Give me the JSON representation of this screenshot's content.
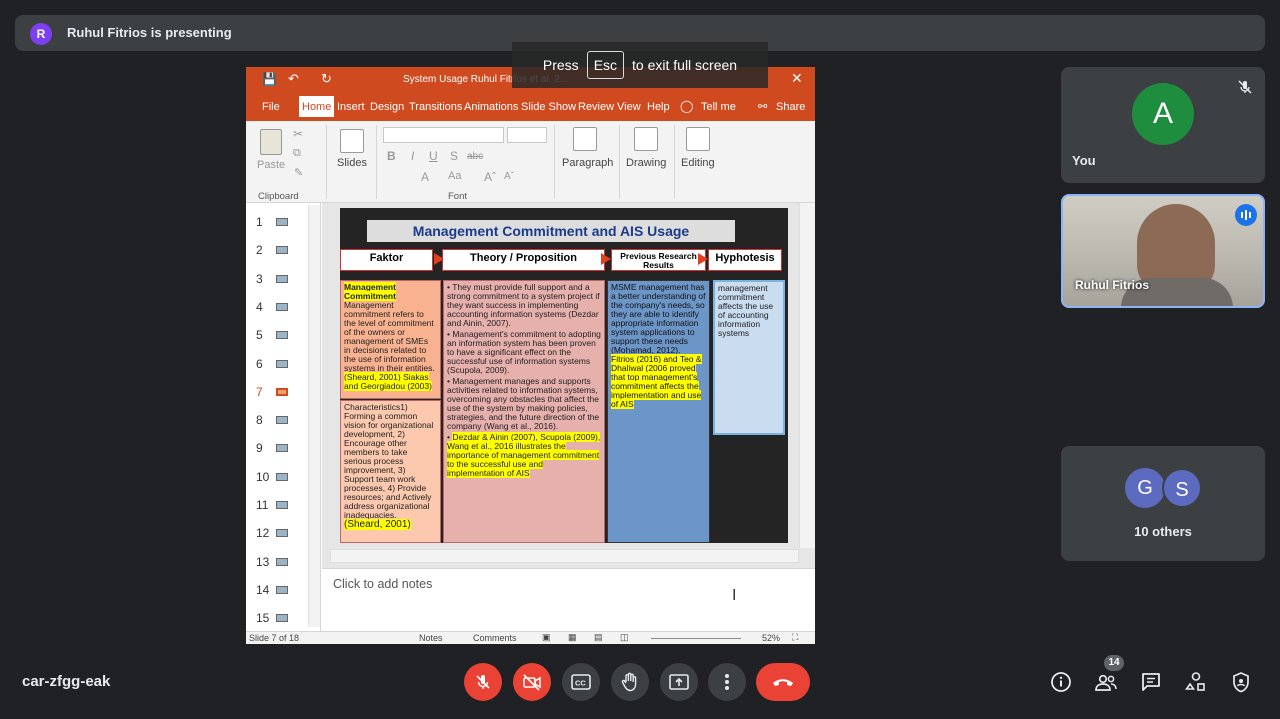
{
  "presenting_bar": {
    "avatar_letter": "R",
    "text": "Ruhul Fitrios is presenting"
  },
  "fullscreen_toast": {
    "before": "Press",
    "key": "Esc",
    "after": "to exit full screen"
  },
  "ppt": {
    "doc_title": "System Usage Ruhul Fitrios et al. 2...",
    "tabs": [
      "File",
      "Home",
      "Insert",
      "Design",
      "Transitions",
      "Animations",
      "Slide Show",
      "Review",
      "View",
      "Help",
      "Tell me",
      "Share"
    ],
    "active_tab": "Home",
    "ribbon": {
      "paste": "Paste",
      "clipboard": "Clipboard",
      "slides": "Slides",
      "font": "Font",
      "paragraph": "Paragraph",
      "drawing": "Drawing",
      "editing": "Editing"
    },
    "thumbnails": [
      "1",
      "2",
      "3",
      "4",
      "5",
      "6",
      "7",
      "8",
      "9",
      "10",
      "11",
      "12",
      "13",
      "14",
      "15"
    ],
    "active_thumbnail": "7",
    "slide": {
      "title": "Management Commitment and AIS Usage",
      "headers": [
        "Faktor",
        "Theory / Proposition",
        "Previous Research Results",
        "Hyphotesis"
      ],
      "col1_title": "Management Commitment",
      "col1_body": "Management commitment refers to the level of commitment of the owners or management of SMEs in decisions related to the use of information systems in their entities.",
      "col1_cite": "(Sheard, 2001) Siakas and Georgiadou (2003)",
      "col1b_body": "Characteristics1) Forming a common vision for organizational development, 2) Encourage other members to take serious process improvement, 3) Support team work processes, 4) Provide resources; and Actively address organizational inadequacies.",
      "col1b_cite": "(Sheard, 2001)",
      "col2_items": [
        "They must provide full support and a strong commitment to a system project if they want success in implementing accounting information systems (Dezdar and Ainin, 2007).",
        "Management's commitment to adopting an information system has been proven to have a significant effect on the successful use of information systems (Scupola, 2009).",
        "Management manages and supports activities related to information systems, overcoming any obstacles that affect the use of the system by making policies, strategies, and the future direction of the company (Wang et al., 2016)."
      ],
      "col2_hl": "Dezdar & Ainin (2007), Scupola (2009), Wang et al., 2016 illustrates the importance of management commitment to the successful use and implementation of AIS",
      "col3_body": "MSME management has a better understanding of the company's needs, so they are able to identify appropriate information system applications to support these needs (Mohamad, 2012).",
      "col3_hl": "Fitrios (2016) and Teo & Dhaliwal (2006 proved that top management's commitment affects the implementation and use of AIS",
      "col4_body": "management commitment affects the use of accounting information systems"
    },
    "notes_placeholder": "Click to add notes",
    "status": {
      "slide": "Slide 7 of 18",
      "notes": "Notes",
      "comments": "Comments",
      "zoom": "52%"
    }
  },
  "tiles": {
    "you": {
      "letter": "A",
      "name": "You",
      "avatar_color": "#1e8e3e"
    },
    "ruhul": {
      "name": "Ruhul Fitrios"
    },
    "others": {
      "letters": [
        "G",
        "S"
      ],
      "label": "10 others"
    }
  },
  "bottom": {
    "meeting_code": "car-zfgg-eak",
    "participants_count": "14"
  },
  "colors": {
    "accent_red": "#ea4335",
    "ppt_orange": "#d04a1f",
    "tile_bg": "#3c4043",
    "active_border": "#8ab4f8"
  }
}
